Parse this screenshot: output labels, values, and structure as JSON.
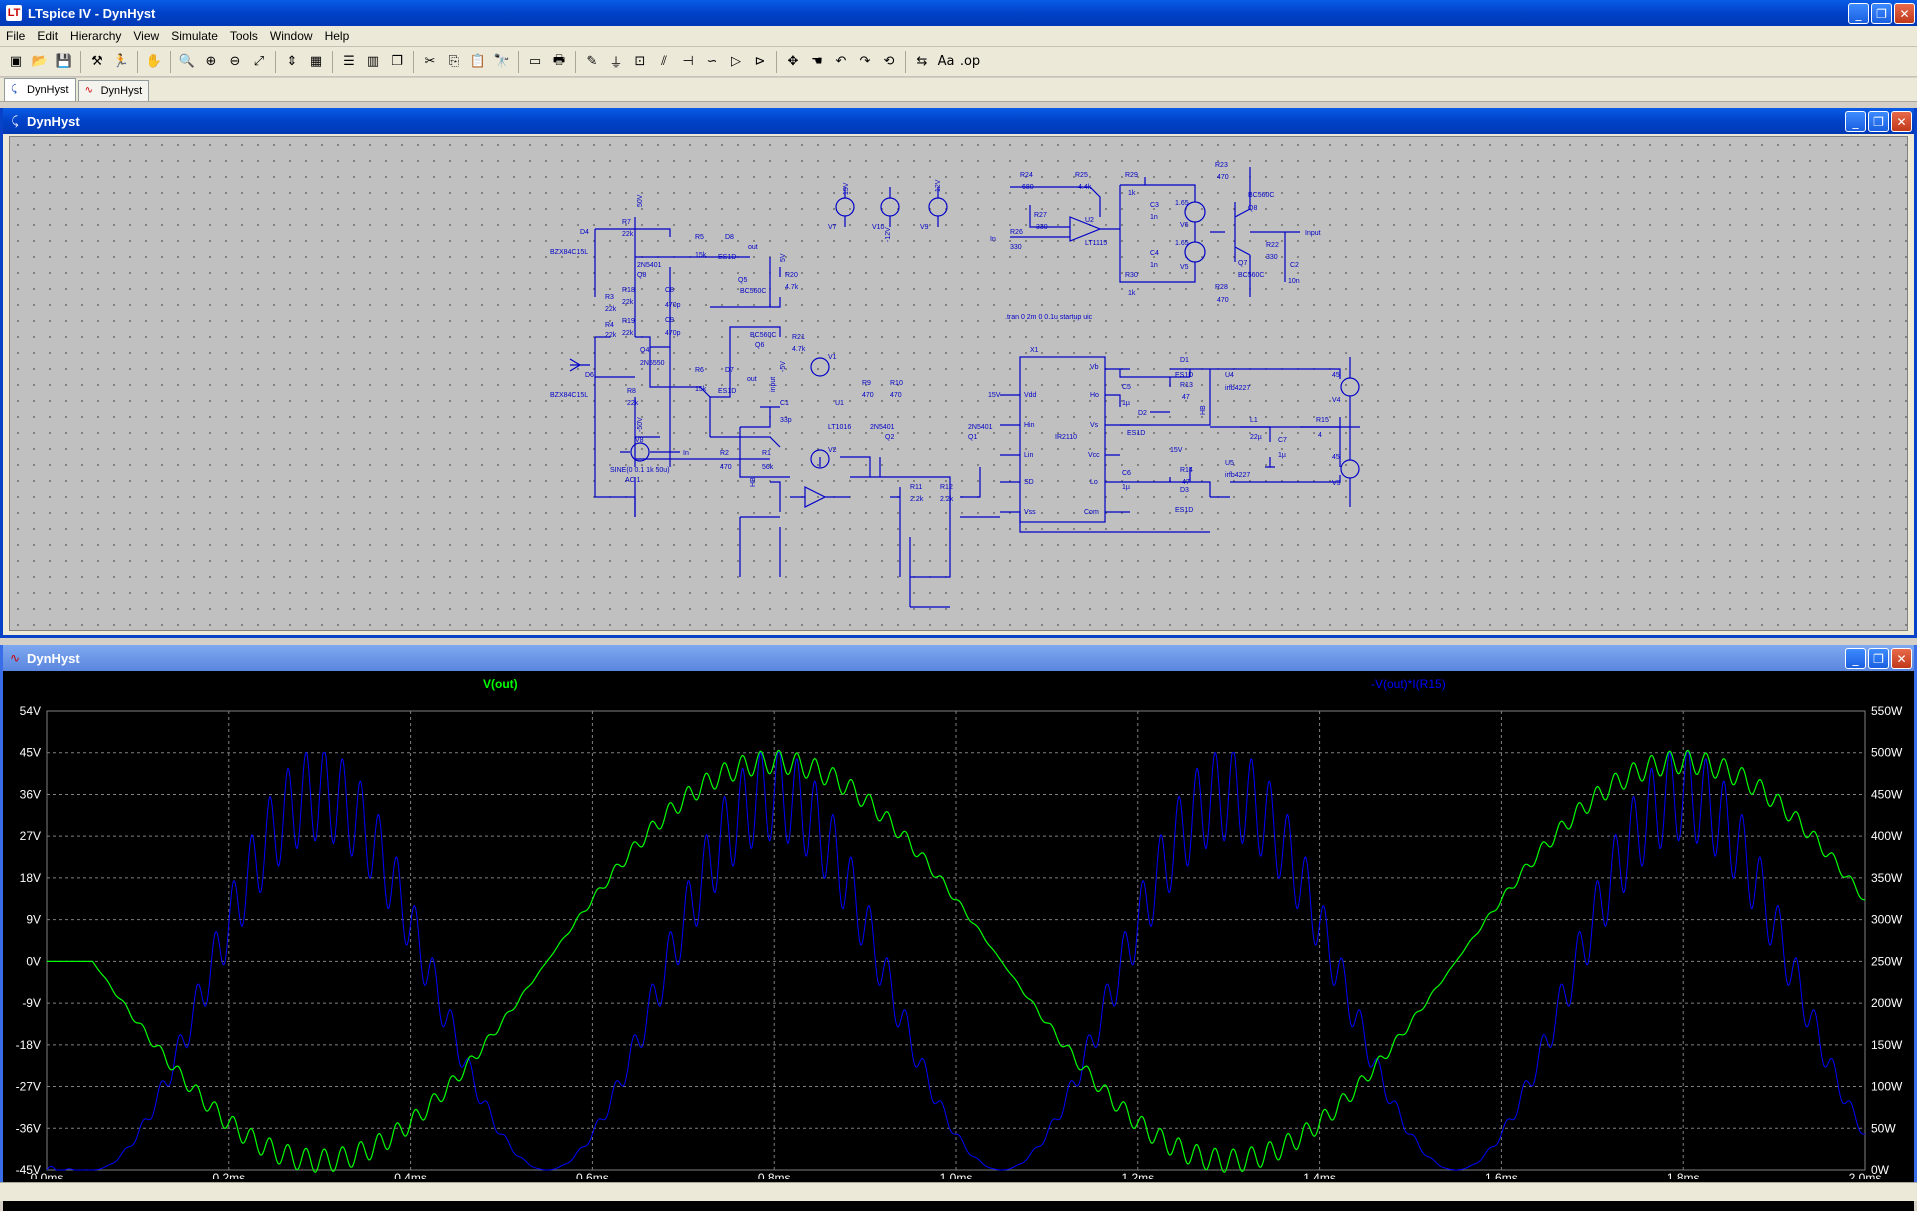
{
  "app": {
    "title": "LTspice IV - DynHyst",
    "icon": "ltspice-logo-icon",
    "icon_text": "LT"
  },
  "menu": [
    "File",
    "Edit",
    "Hierarchy",
    "View",
    "Simulate",
    "Tools",
    "Window",
    "Help"
  ],
  "toolbar": {
    "buttons": [
      "new-schematic-icon",
      "open-icon",
      "save-icon",
      "control-panel-icon",
      "run-icon",
      "pan-icon",
      "zoom-in-icon",
      "zoom-rect-icon",
      "zoom-out-icon",
      "zoom-fit-icon",
      "autorange-icon",
      "grid-icon",
      "tile-horizontal-icon",
      "tile-vertical-icon",
      "cascade-icon",
      "cut-icon",
      "copy-icon",
      "paste-icon",
      "find-icon",
      "print-setup-icon",
      "print-icon",
      "wire-icon",
      "ground-icon",
      "label-icon",
      "resistor-icon",
      "capacitor-icon",
      "inductor-icon",
      "diode-icon",
      "component-icon",
      "move-icon",
      "drag-icon",
      "undo-icon",
      "redo-icon",
      "rotate-icon",
      "mirror-icon",
      "text-icon",
      "spice-directive-icon"
    ],
    "glyphs": [
      "▣",
      "📂",
      "💾",
      "⚒",
      "🏃",
      "✋",
      "🔍",
      "⊕",
      "⊖",
      "⤢",
      "⇕",
      "▦",
      "☰",
      "▥",
      "❐",
      "✂",
      "⎘",
      "📋",
      "🔭",
      "▭",
      "🖶",
      "✎",
      "⏚",
      "⊡",
      "⫽",
      "⊣",
      "∽",
      "▷",
      "⊳",
      "✥",
      "☚",
      "↶",
      "↷",
      "⟲",
      "⇆",
      "Aa",
      ".op"
    ]
  },
  "tabs": [
    {
      "label": "DynHyst",
      "icon": "schematic-icon",
      "glyph": "⤹",
      "active": true
    },
    {
      "label": "DynHyst",
      "icon": "waveform-icon",
      "glyph": "∿",
      "active": false
    }
  ],
  "schematic_window": {
    "title": "DynHyst",
    "icon": "schematic-icon",
    "directive": ".tran 0 2m 0 0.1u startup uic",
    "labels": {
      "r7": "R7",
      "r7v": "22k",
      "d4": "D4",
      "d4m": "BZX84C15L",
      "q8": "Q8",
      "q8m": "2N5401",
      "r5": "R5",
      "r5v": "15k",
      "d8": "D8",
      "d8m": "ES1D",
      "out": "out",
      "r3": "R3",
      "r3v": "22k",
      "r18": "R18",
      "r18v": "22k",
      "c8": "C8",
      "c8v": "470p",
      "q5": "Q5",
      "q5m": "BC560C",
      "r20": "R20",
      "r20v": "4.7k",
      "r4": "R4",
      "r4v": "22k",
      "r19": "R19",
      "r19v": "22k",
      "c9": "C9",
      "c9v": "470p",
      "q6": "Q6",
      "q6m": "BC560C",
      "q4": "Q4",
      "q4m": "2N5550",
      "r21": "R21",
      "r21v": "4.7k",
      "d6": "D6",
      "d6m": "BZX84C15L",
      "r8": "R8",
      "r8v": "22k",
      "r6": "R6",
      "r6v": "15k",
      "d7": "D7",
      "d7m": "ES1D",
      "v50p": "50V",
      "v50n": "-50V",
      "v5p": "5V",
      "v5n": "-5V",
      "v7": "V7",
      "v10": "V10",
      "v9": "V9",
      "v15": "15V",
      "v12p": "12V",
      "v12n": "-12V",
      "r24": "R24",
      "r24v": "680",
      "r25": "R25",
      "r25v": "4.4k",
      "r27": "R27",
      "r27v": "330",
      "u2": "U2",
      "u2m": "LT1115",
      "r26": "R26",
      "r26v": "330",
      "in": "In",
      "r29": "R29",
      "r29v": "1k",
      "r30": "R30",
      "r30v": "1k",
      "c3": "C3",
      "c3v": "1n",
      "c4": "C4",
      "c4v": "1n",
      "v5": "V5",
      "v6": "V6",
      "v5a": "1.65",
      "v6a": "1.65",
      "r23": "R23",
      "r23v": "470",
      "q8b": "Q8",
      "q8bm": "BC560C",
      "q7": "Q7",
      "q7m": "BC560C",
      "r22": "R22",
      "r22v": "330",
      "c2": "C2",
      "c2v": "10n",
      "input": "Input",
      "r28": "R28",
      "r28v": "470",
      "x1": "X1",
      "ic": "IR2110",
      "vdd": "Vdd",
      "vb": "Vb",
      "ho": "Ho",
      "vs": "Vs",
      "hin": "Hin",
      "lin": "Lin",
      "sd": "SD",
      "vcc": "Vcc",
      "lo": "Lo",
      "vss": "Vss",
      "com": "Com",
      "v15l": "15V",
      "c5": "C5",
      "c5v": "1µ",
      "c6": "C6",
      "c6v": "1µ",
      "d2": "D2",
      "d2m": "ES1D",
      "d1": "D1",
      "d1m": "ES1D",
      "d3": "D3",
      "d3m": "ES1D",
      "r13": "R13",
      "r13v": "47",
      "r14": "R14",
      "r14v": "47",
      "u4": "U4",
      "u4m": "irfb4227",
      "u5": "U5",
      "u5m": "irfb4227",
      "hb": "HB",
      "l1": "L1",
      "l1v": "22µ",
      "c7": "C7",
      "c7v": "1µ",
      "r15": "R15",
      "r15v": "4",
      "v4": "V4",
      "v4v": "45",
      "v3": "V3",
      "v3v": "45",
      "v1": "V1",
      "v2": "V2",
      "u1": "U1",
      "u1m": "LT1016",
      "c1": "C1",
      "c1v": "33p",
      "q2": "Q2",
      "q2m": "2N5401",
      "q1": "Q1",
      "q1m": "2N5401",
      "r9": "R9",
      "r9v": "470",
      "r10": "R10",
      "r10v": "470",
      "r2": "R2",
      "r2v": "470",
      "r1": "R1",
      "r1v": "56k",
      "r11": "R11",
      "r11v": "2.2k",
      "r12": "R12",
      "r12v": "2.2k",
      "inp": "input",
      "v8": "V8",
      "v8src": "SINE(0 0.1 1k 50u)",
      "v8ac": "AC 1",
      "in2": "In",
      "hb2": "HB",
      "out2": "out",
      "v15s": "15V",
      "v15s2": "15V"
    }
  },
  "plot_window": {
    "title": "DynHyst",
    "icon": "waveform-icon",
    "trace1_label": "V(out)",
    "trace2_label": "-V(out)*I(R15)",
    "trace1_color": "#00ff00",
    "trace2_color": "#0000ff",
    "background": "#000000",
    "grid_color": "#808080"
  },
  "chart_data": {
    "type": "line",
    "x_ticks": [
      "0.0ms",
      "0.2ms",
      "0.4ms",
      "0.6ms",
      "0.8ms",
      "1.0ms",
      "1.2ms",
      "1.4ms",
      "1.6ms",
      "1.8ms",
      "2.0ms"
    ],
    "y_left_ticks": [
      "54V",
      "45V",
      "36V",
      "27V",
      "18V",
      "9V",
      "0V",
      "-9V",
      "-18V",
      "-27V",
      "-36V",
      "-45V"
    ],
    "y_right_ticks": [
      "550W",
      "500W",
      "450W",
      "400W",
      "350W",
      "300W",
      "250W",
      "200W",
      "150W",
      "100W",
      "50W",
      "0W"
    ],
    "xlim": [
      0,
      2.0
    ],
    "ylim_left": [
      -45,
      54
    ],
    "ylim_right": [
      0,
      550
    ],
    "series": [
      {
        "name": "V(out)",
        "axis": "left",
        "amplitude": 43,
        "frequency_khz": 1,
        "start_ms": 0.05,
        "ripple": 2.5,
        "ripple_khz": 50
      },
      {
        "name": "-V(out)*I(R15)",
        "axis": "right",
        "peak": 450,
        "frequency_khz": 1,
        "ripple": 55,
        "ripple_khz": 50
      }
    ]
  }
}
